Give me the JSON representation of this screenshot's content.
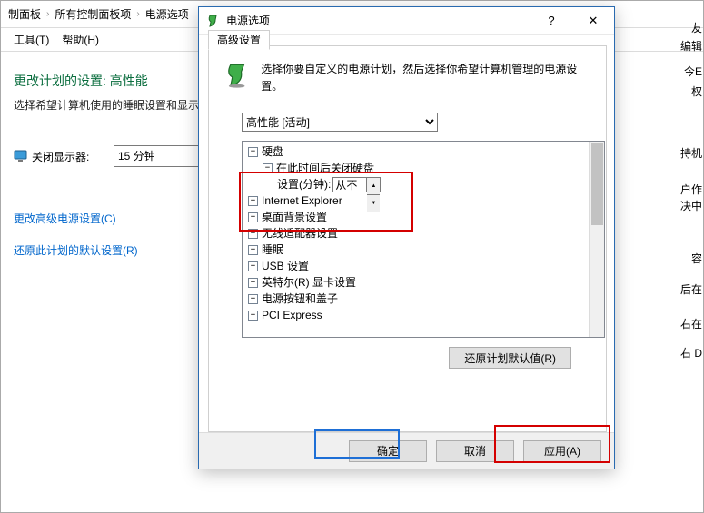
{
  "cp": {
    "breadcrumb": [
      "制面板",
      "所有控制面板项",
      "电源选项"
    ],
    "menu": {
      "tools": "工具(T)",
      "help": "帮助(H)"
    },
    "title": "更改计划的设置: 高性能",
    "desc": "选择希望计算机使用的睡眠设置和显示",
    "turn_off_display_label": "关闭显示器:",
    "display_value": "15 分钟",
    "link_advanced": "更改高级电源设置(C)",
    "link_restore": "还原此计划的默认设置(R)"
  },
  "rightFragments": {
    "a": "友",
    "b": "编辑",
    "c": "今E",
    "d": "权",
    "e": "持机",
    "f": "户作",
    "g": "决中",
    "h": "容",
    "i": "后在",
    "j": "右在",
    "k": "右 D"
  },
  "dlg": {
    "title": "电源选项",
    "tab": "高级设置",
    "intro": "选择你要自定义的电源计划，然后选择你希望计算机管理的电源设置。",
    "plan_selected": "高性能 [活动]",
    "tree": {
      "hard_disk": "硬盘",
      "turn_off_after": "在此时间后关闭硬盘",
      "setting_label": "设置(分钟):",
      "setting_value": "从不",
      "ie": "Internet Explorer",
      "desktop_bg": "桌面背景设置",
      "wireless": "无线适配器设置",
      "sleep": "睡眠",
      "usb": "USB 设置",
      "intel": "英特尔(R) 显卡设置",
      "power_btn": "电源按钮和盖子",
      "pci": "PCI Express"
    },
    "restore_btn": "还原计划默认值(R)",
    "ok": "确定",
    "cancel": "取消",
    "apply": "应用(A)"
  }
}
